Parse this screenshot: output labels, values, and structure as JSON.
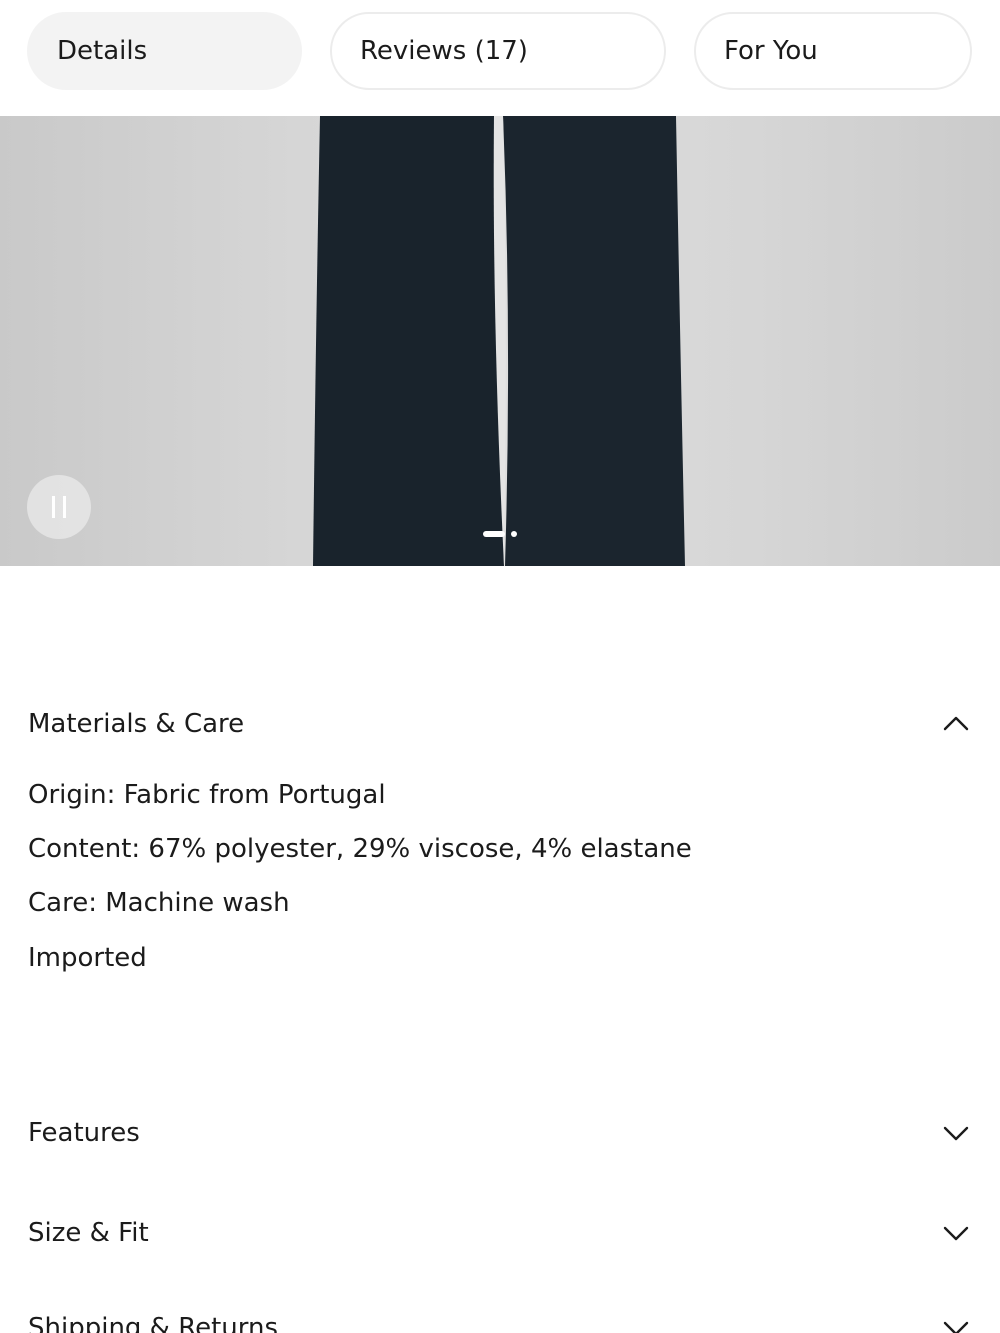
{
  "tabs": [
    {
      "label": "Details",
      "active": true
    },
    {
      "label": "Reviews (17)",
      "active": false
    },
    {
      "label": "For You",
      "active": false
    }
  ],
  "media": {
    "pause_icon": "pause-icon",
    "carousel_dots": 2,
    "active_slide": 1
  },
  "accordion": {
    "materials": {
      "title": "Materials & Care",
      "expanded": true,
      "lines": [
        "Origin: Fabric from Portugal",
        "Content: 67% polyester, 29% viscose, 4% elastane",
        "Care: Machine wash",
        "Imported"
      ]
    },
    "features": {
      "title": "Features",
      "expanded": false
    },
    "size_fit": {
      "title": "Size & Fit",
      "expanded": false
    },
    "shipping": {
      "title": "Shipping & Returns",
      "expanded": false
    }
  },
  "colors": {
    "tab_active_bg": "#f3f3f3",
    "tab_border": "#ececec",
    "pants": "#19232c",
    "text": "#1b1b1b"
  }
}
